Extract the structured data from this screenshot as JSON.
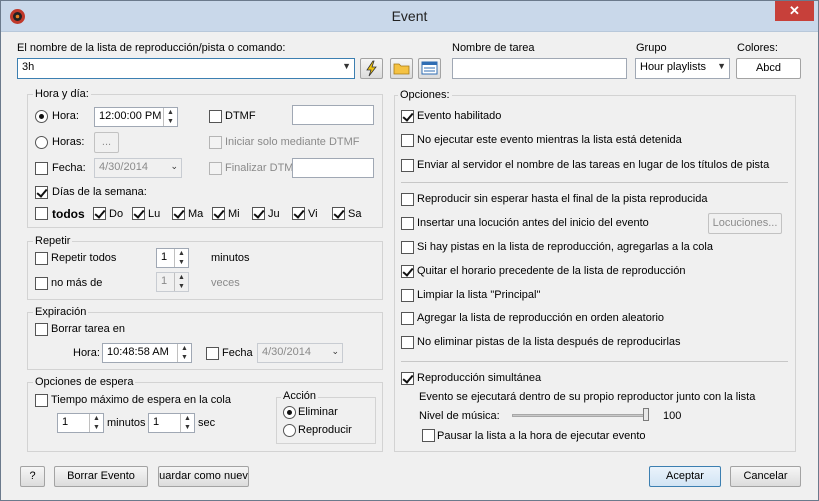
{
  "window": {
    "title": "Event",
    "close_glyph": "✕"
  },
  "top": {
    "playlist_label": "El nombre de la lista de reproducción/pista o comando:",
    "playlist_value": "3h",
    "task_name_label": "Nombre de tarea",
    "task_name_value": "",
    "group_label": "Grupo",
    "group_value": "Hour playlists",
    "colors_label": "Colores:",
    "colors_button": "Abcd"
  },
  "time_group": {
    "title": "Hora y día:",
    "hora_label": "Hora:",
    "hora_value": "12:00:00 PM",
    "horas_label": "Horas:",
    "horas_button": "...",
    "fecha_label": "Fecha:",
    "fecha_value": "4/30/2014",
    "dtmf_label": "DTMF",
    "iniciar_dtmf_label": "Iniciar solo mediante DTMF",
    "finalizar_dtmf_label": "Finalizar DTMF",
    "dias_label": "Días de la semana:",
    "todos_label": "todos",
    "days": [
      "Do",
      "Lu",
      "Ma",
      "Mi",
      "Ju",
      "Vi",
      "Sa"
    ]
  },
  "repeat_group": {
    "title": "Repetir",
    "repetir_label": "Repetir todos",
    "repetir_value": "1",
    "minutos_label": "minutos",
    "nomas_label": "no más de",
    "nomas_value": "1",
    "veces_label": "veces"
  },
  "expiration_group": {
    "title": "Expiración",
    "borrar_label": "Borrar tarea en",
    "hora_label": "Hora:",
    "hora_value": "10:48:58 AM",
    "fecha_label": "Fecha",
    "fecha_value": "4/30/2014"
  },
  "wait_group": {
    "title": "Opciones de espera",
    "tiempo_label": "Tiempo máximo de espera en la cola",
    "min_value": "1",
    "minutos_label": "minutos",
    "sec_value": "1",
    "sec_label": "sec"
  },
  "action_group": {
    "title": "Acción",
    "eliminar_label": "Eliminar",
    "reproducir_label": "Reproducir"
  },
  "options": {
    "title": "Opciones:",
    "evento_habilitado": "Evento habilitado",
    "no_ejecutar": "No ejecutar este evento mientras la lista está detenida",
    "enviar_servidor": "Enviar al servidor el nombre de las tareas en lugar de los títulos de pista",
    "reproducir_sin_esperar": "Reproducir sin esperar hasta el final de la pista reproducida",
    "insertar_locucion": "Insertar una locución antes del inicio del evento",
    "locuciones_button": "Locuciones...",
    "si_hay_pistas": "Si hay pistas en la lista de reproducción, agregarlas a la cola",
    "quitar_horario": "Quitar el horario precedente de la lista de reproducción",
    "limpiar_lista": "Limpiar la lista \"Principal\"",
    "agregar_aleatorio": "Agregar la lista de reproducción en orden aleatorio",
    "no_eliminar": "No eliminar pistas de la lista después de reproducirlas",
    "reproduccion_simultanea": "Reproducción simultánea",
    "evento_propio_reproductor": "Evento se ejecutará dentro de su propio reproductor junto con la lista",
    "nivel_musica_label": "Nivel de música:",
    "nivel_musica_value": "100",
    "nivel_musica_fraction": 1.0,
    "pausar_lista": "Pausar la lista a la hora de ejecutar evento"
  },
  "bottom": {
    "help_button": "?",
    "borrar_evento_button": "Borrar Evento",
    "guardar_button": "uardar como nuev",
    "aceptar_button": "Aceptar",
    "cancelar_button": "Cancelar"
  },
  "icons": {
    "app": "media-player-icon",
    "lightning": "lightning-icon",
    "folder": "folder-icon",
    "list": "list-icon"
  },
  "colors": {
    "titlebar": "#c9d8ea",
    "close": "#c7403a",
    "background": "#f0f0f0"
  }
}
